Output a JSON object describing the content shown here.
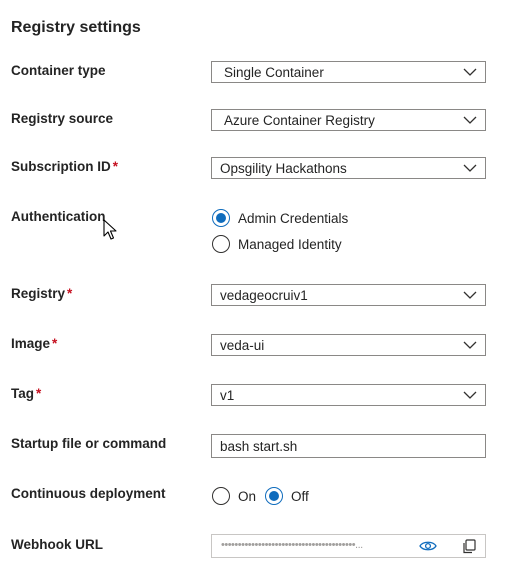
{
  "heading": "Registry settings",
  "fields": {
    "container_type": {
      "label": "Container type",
      "value": "Single Container"
    },
    "registry_source": {
      "label": "Registry source",
      "value": "Azure Container Registry"
    },
    "subscription_id": {
      "label": "Subscription ID",
      "required": "*",
      "value": "Opsgility Hackathons"
    },
    "authentication": {
      "label": "Authentication",
      "options": [
        "Admin Credentials",
        "Managed Identity"
      ],
      "selected": "Admin Credentials"
    },
    "registry": {
      "label": "Registry",
      "required": "*",
      "value": "vedageocruiv1"
    },
    "image": {
      "label": "Image",
      "required": "*",
      "value": "veda-ui"
    },
    "tag": {
      "label": "Tag",
      "required": "*",
      "value": "v1"
    },
    "startup": {
      "label": "Startup file or command",
      "value": "bash start.sh"
    },
    "continuous_deployment": {
      "label": "Continuous deployment",
      "options": [
        "On",
        "Off"
      ],
      "selected": "Off"
    },
    "webhook": {
      "label": "Webhook URL",
      "masked_value": "••••••••••••••••••••••••••••••••••••••••..."
    }
  },
  "icons": {
    "chevron": "chevron-down-icon",
    "eye": "eye-icon",
    "copy": "copy-icon"
  },
  "colors": {
    "accent": "#0f6cbd",
    "required": "#c50f1f",
    "border": "#8a8886"
  }
}
